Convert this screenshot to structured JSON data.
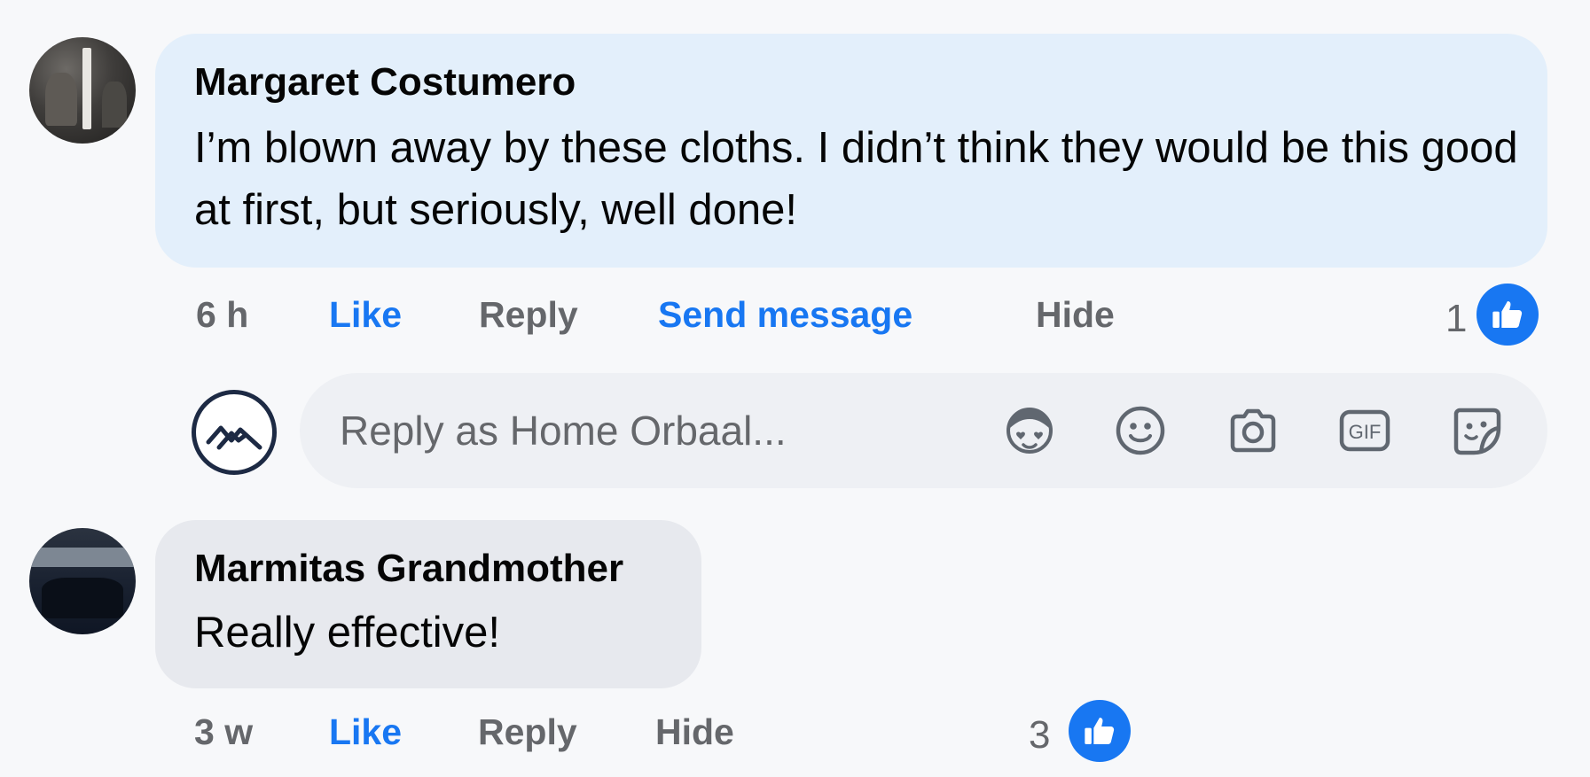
{
  "comments": [
    {
      "author": "Margaret Costumero",
      "text": "I’m blown away by these cloths. I didn’t think they would be this good at first, but seriously, well done!",
      "timestamp": "6 h",
      "actions": {
        "like": "Like",
        "reply": "Reply",
        "send_message": "Send message",
        "hide": "Hide"
      },
      "reaction_count": "1"
    },
    {
      "author": "Marmitas Grandmother",
      "text": "Really effective!",
      "timestamp": "3 w",
      "actions": {
        "like": "Like",
        "reply": "Reply",
        "hide": "Hide"
      },
      "reaction_count": "3"
    }
  ],
  "reply_composer": {
    "placeholder": "Reply as Home Orbaal...",
    "icons": [
      "avatar-sticker-icon",
      "emoji-icon",
      "camera-icon",
      "gif-icon",
      "sticker-icon"
    ],
    "gif_label": "GIF"
  },
  "colors": {
    "accent": "#1877f2",
    "secondary_text": "#65676b",
    "highlight_bubble": "#e3effb",
    "normal_bubble": "#e7e9ee"
  }
}
